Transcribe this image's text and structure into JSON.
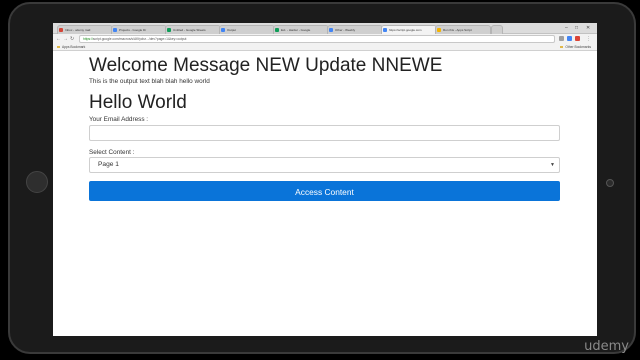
{
  "browser": {
    "tabs": [
      {
        "label": "Inbox - udemy mail",
        "color": "#d44638"
      },
      {
        "label": "Projects - Google Dr",
        "color": "#4285f4"
      },
      {
        "label": "Untitled - Google Sheets",
        "color": "#0f9d58"
      },
      {
        "label": "Output",
        "color": "#4285f4"
      },
      {
        "label": "Ext. - Harder - Google",
        "color": "#0f9d58"
      },
      {
        "label": "Other - Weebly",
        "color": "#4285f4"
      },
      {
        "label": "https://script.google.com",
        "color": "#4285f4"
      },
      {
        "label": "Run this - Apps Script",
        "color": "#f4b400"
      }
    ],
    "url_scheme": "https://",
    "url": "script.google.com/macros/s/AKfycbz.../dev?page=1&key=output",
    "bookmarks_left": "Apps Bookmark",
    "bookmarks_right": "Other Bookmarks"
  },
  "page": {
    "welcome_heading": "Welcome Message NEW Update NNEWE",
    "output_text": "This is the output text blah blah hello world",
    "hello_heading": "Hello World",
    "email_label": "Your Email Address :",
    "email_value": "",
    "select_label": "Select Content :",
    "select_value": "Page 1",
    "button_label": "Access Content"
  },
  "colors": {
    "button": "#0a74d9"
  },
  "watermark": "udemy"
}
